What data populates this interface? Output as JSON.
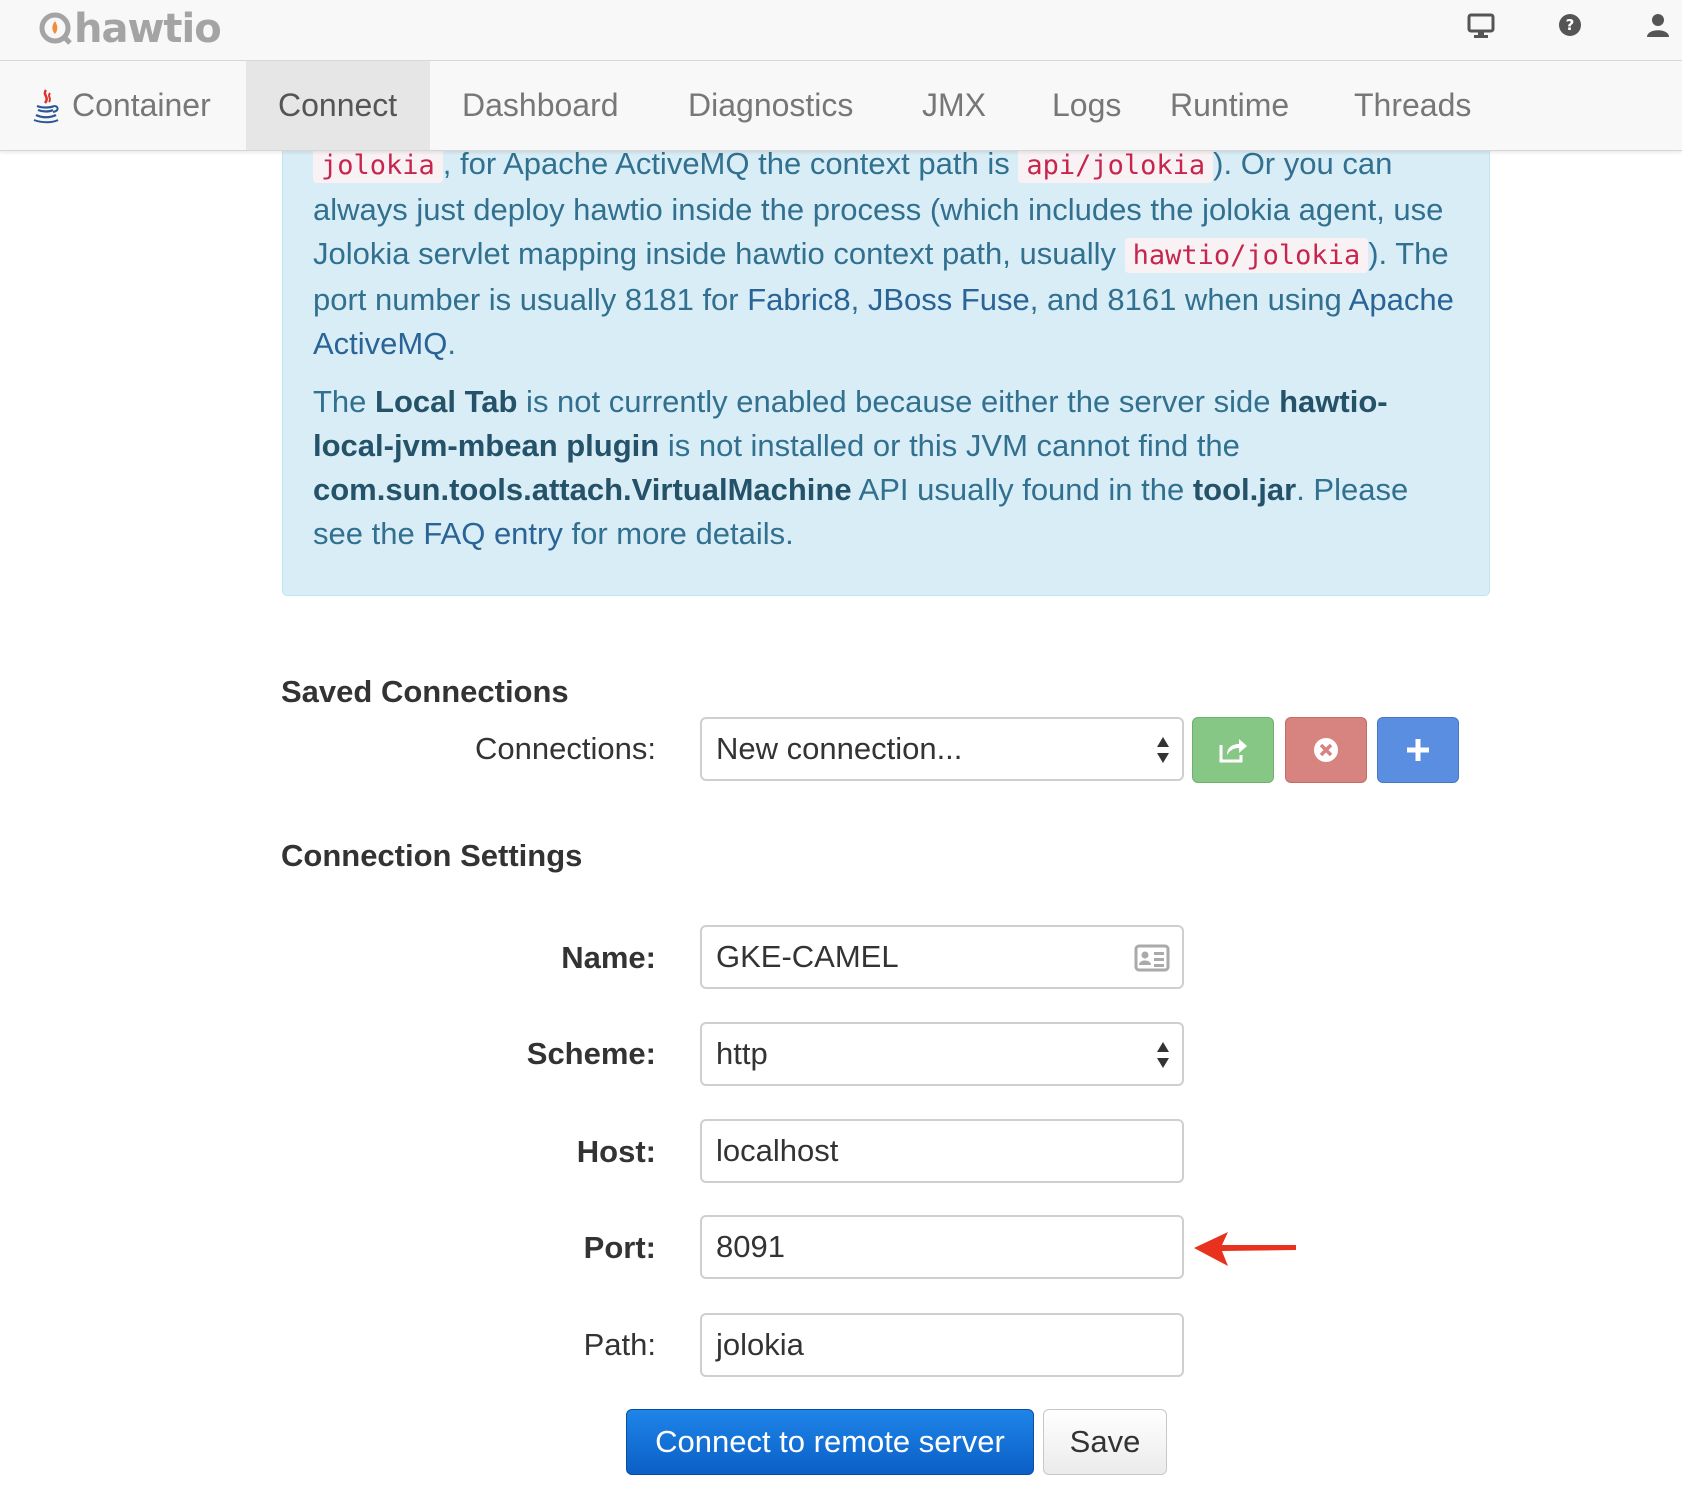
{
  "header": {
    "brand": "hawtio",
    "icons": [
      "monitor-icon",
      "help-icon",
      "user-icon"
    ]
  },
  "nav": {
    "tabs": [
      {
        "label": "Container",
        "icon": "java-icon"
      },
      {
        "label": "Connect",
        "active": true
      },
      {
        "label": "Dashboard"
      },
      {
        "label": "Diagnostics"
      },
      {
        "label": "JMX"
      },
      {
        "label": "Logs"
      },
      {
        "label": "Runtime"
      },
      {
        "label": "Threads"
      }
    ]
  },
  "info": {
    "p1": {
      "code1": "jolokia",
      "t1": ", for Apache ActiveMQ the context path is ",
      "code2": "api/jolokia",
      "t2": "). Or you can always just deploy hawtio inside the process (which includes the jolokia agent, use Jolokia servlet mapping inside hawtio context path, usually ",
      "code3": "hawtio/jolokia",
      "t3": "). The port number is usually 8181 for ",
      "link1": "Fabric8",
      "t4": ", ",
      "link2": "JBoss Fuse",
      "t5": ", and 8161 when using ",
      "link3": "Apache ActiveMQ",
      "t6": "."
    },
    "p2": {
      "t1": "The ",
      "b1": "Local Tab",
      "t2": " is not currently enabled because either the server side ",
      "b2": "hawtio-local-jvm-mbean plugin",
      "t3": " is not installed or this JVM cannot find the ",
      "b3": "com.sun.tools.attach.VirtualMachine",
      "t4": " API usually found in the ",
      "b4": "tool.jar",
      "t5": ". Please see the ",
      "link1": "FAQ entry",
      "t6": " for more details."
    }
  },
  "saved_connections": {
    "title": "Saved Connections",
    "label": "Connections:",
    "selected": "New connection..."
  },
  "settings": {
    "title": "Connection Settings",
    "name_label": "Name:",
    "name_value": "GKE-CAMEL",
    "scheme_label": "Scheme:",
    "scheme_value": "http",
    "host_label": "Host:",
    "host_value": "localhost",
    "port_label": "Port:",
    "port_value": "8091",
    "path_label": "Path:",
    "path_value": "jolokia"
  },
  "actions": {
    "connect": "Connect to remote server",
    "save": "Save"
  },
  "colors": {
    "alert_bg": "#d9edf7",
    "alert_text": "#31708f",
    "primary": "#1e85e8",
    "annotation_arrow": "#e8321e"
  }
}
